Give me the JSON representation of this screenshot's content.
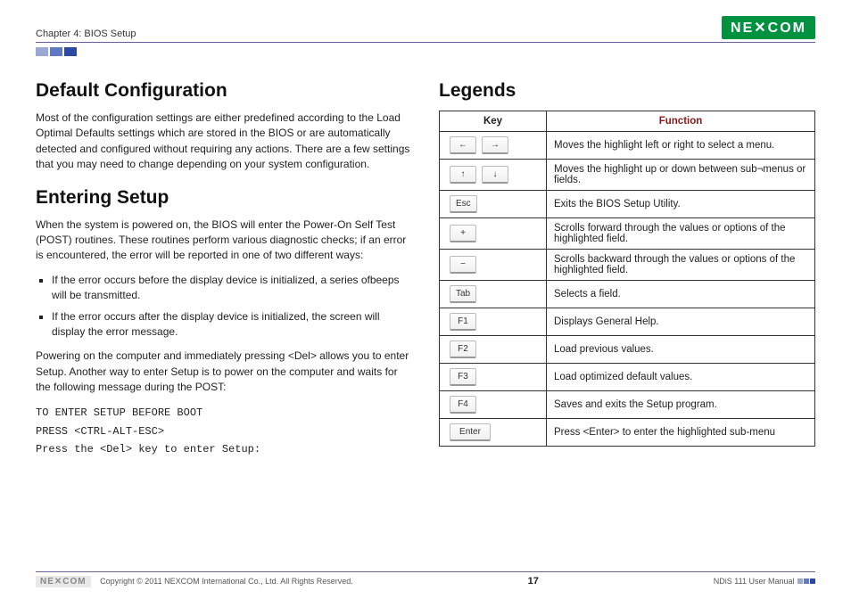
{
  "header": {
    "chapter": "Chapter 4: BIOS Setup",
    "brand": "NE✕COM"
  },
  "left": {
    "h1": "Default Configuration",
    "p1": "Most of the configuration settings are either predefined according to the Load Optimal Defaults settings which are stored in the BIOS or are automatically detected and configured without requiring any actions. There are a few settings that you may need to change depending on your system configuration.",
    "h2": "Entering Setup",
    "p2": "When the system is powered on, the BIOS will enter the Power-On Self Test (POST) routines. These routines perform various diagnostic checks; if an error is encountered, the error will be reported in one of two different ways:",
    "li1": "If the error occurs before the display device is initialized, a series ofbeeps will be transmitted.",
    "li2": "If the error occurs after the display device is initialized, the screen will display the error message.",
    "p3": "Powering on the computer and immediately pressing <Del> allows you to enter Setup. Another way to enter Setup is to power on the computer and waits for the following message during the POST:",
    "m1": "TO ENTER SETUP BEFORE BOOT",
    "m2": "PRESS <CTRL-ALT-ESC>",
    "m3": "Press the <Del> key to enter Setup:"
  },
  "right": {
    "title": "Legends",
    "thKey": "Key",
    "thFunc": "Function",
    "rows": [
      {
        "keys": [
          "←",
          "→"
        ],
        "fn": "Moves the highlight left or right to select a menu."
      },
      {
        "keys": [
          "↑",
          "↓"
        ],
        "fn": "Moves the highlight up or down between sub¬menus or fields."
      },
      {
        "keys": [
          "Esc"
        ],
        "fn": "Exits the BIOS Setup Utility."
      },
      {
        "keys": [
          "+"
        ],
        "fn": "Scrolls forward through the values or options of the highlighted field."
      },
      {
        "keys": [
          "−"
        ],
        "fn": "Scrolls backward through the values or options of the highlighted field."
      },
      {
        "keys": [
          "Tab"
        ],
        "fn": "Selects a field."
      },
      {
        "keys": [
          "F1"
        ],
        "fn": "Displays General Help."
      },
      {
        "keys": [
          "F2"
        ],
        "fn": "Load previous values."
      },
      {
        "keys": [
          "F3"
        ],
        "fn": "Load optimized default values."
      },
      {
        "keys": [
          "F4"
        ],
        "fn": "Saves and exits the Setup program."
      },
      {
        "keys": [
          "Enter"
        ],
        "wide": true,
        "fn": "Press <Enter> to enter the highlighted sub-menu"
      }
    ]
  },
  "footer": {
    "copyright": "Copyright © 2011 NEXCOM International Co., Ltd. All Rights Reserved.",
    "page": "17",
    "manual": "NDiS 111 User Manual",
    "flogo": "NE✕COM"
  }
}
